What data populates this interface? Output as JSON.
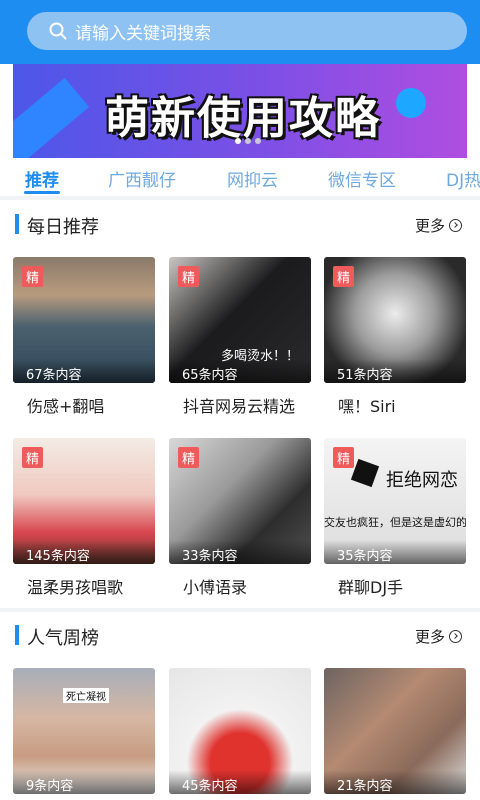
{
  "search": {
    "placeholder": "请输入关键词搜索"
  },
  "banner": {
    "title": "萌新使用攻略"
  },
  "tabs": [
    "推荐",
    "广西靓仔",
    "网抑云",
    "微信专区",
    "DJ热"
  ],
  "sections": [
    {
      "title": "每日推荐",
      "more": "更多",
      "cards": [
        {
          "badge": "精",
          "count": "67条内容",
          "title": "伤感+翻唱"
        },
        {
          "badge": "精",
          "count": "65条内容",
          "title": "抖音网易云精选",
          "overlay": "多喝烫水！！"
        },
        {
          "badge": "精",
          "count": "51条内容",
          "title": "嘿！Siri"
        },
        {
          "badge": "精",
          "count": "145条内容",
          "title": "温柔男孩唱歌"
        },
        {
          "badge": "精",
          "count": "33条内容",
          "title": "小傅语录"
        },
        {
          "badge": "精",
          "count": "35条内容",
          "title": "群聊DJ手",
          "overlay_big": "拒绝网恋",
          "overlay_small": "交友也疯狂，但是这是虚幻的"
        }
      ]
    },
    {
      "title": "人气周榜",
      "more": "更多",
      "cards": [
        {
          "count": "9条内容",
          "overlay": "死亡凝视"
        },
        {
          "count": "45条内容"
        },
        {
          "count": "21条内容"
        }
      ]
    }
  ]
}
